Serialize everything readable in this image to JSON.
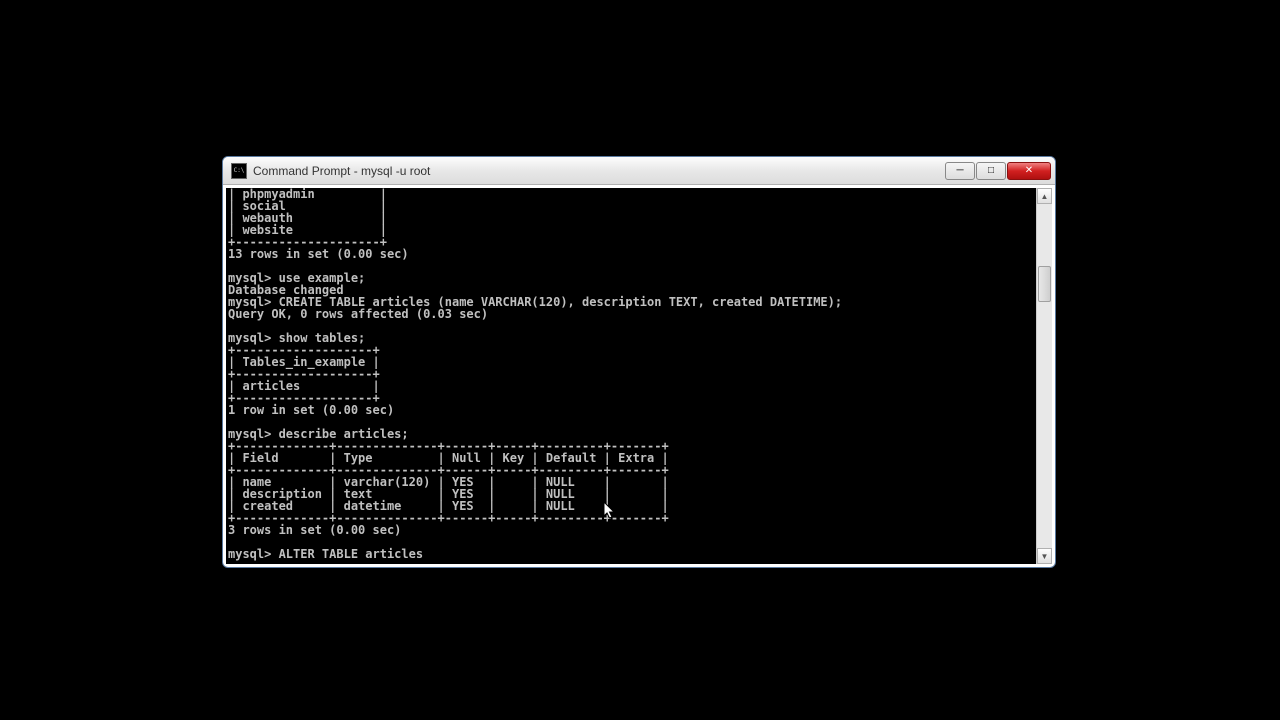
{
  "window": {
    "title": "Command Prompt - mysql  -u root"
  },
  "terminal": {
    "lines": [
      "| phpmyadmin         |",
      "| social             |",
      "| webauth            |",
      "| website            |",
      "+--------------------+",
      "13 rows in set (0.00 sec)",
      "",
      "mysql> use example;",
      "Database changed",
      "mysql> CREATE TABLE articles (name VARCHAR(120), description TEXT, created DATETIME);",
      "Query OK, 0 rows affected (0.03 sec)",
      "",
      "mysql> show tables;",
      "+-------------------+",
      "| Tables_in_example |",
      "+-------------------+",
      "| articles          |",
      "+-------------------+",
      "1 row in set (0.00 sec)",
      "",
      "mysql> describe articles;",
      "+-------------+--------------+------+-----+---------+-------+",
      "| Field       | Type         | Null | Key | Default | Extra |",
      "+-------------+--------------+------+-----+---------+-------+",
      "| name        | varchar(120) | YES  |     | NULL    |       |",
      "| description | text         | YES  |     | NULL    |       |",
      "| created     | datetime     | YES  |     | NULL    |       |",
      "+-------------+--------------+------+-----+---------+-------+",
      "3 rows in set (0.00 sec)",
      "",
      "mysql> ALTER TABLE articles"
    ]
  },
  "buttons": {
    "minimize": "─",
    "maximize": "□",
    "close": "✕"
  },
  "scrollbar": {
    "up": "▲",
    "down": "▼"
  }
}
